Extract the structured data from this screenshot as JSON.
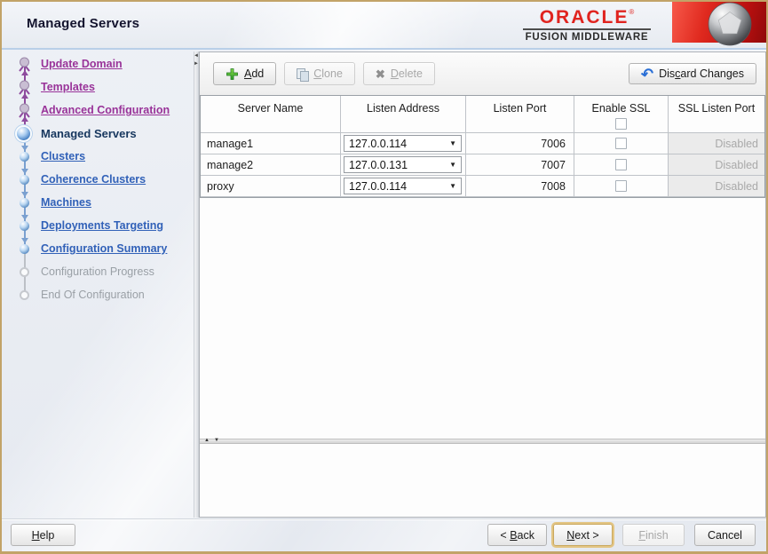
{
  "window_title": "Managed Servers",
  "brand": {
    "name": "ORACLE",
    "registered": "®",
    "subtitle": "FUSION MIDDLEWARE"
  },
  "sidebar": {
    "items": [
      {
        "label": "Update Domain",
        "state": "visited"
      },
      {
        "label": "Templates",
        "state": "visited"
      },
      {
        "label": "Advanced Configuration",
        "state": "visited"
      },
      {
        "label": "Managed Servers",
        "state": "current"
      },
      {
        "label": "Clusters",
        "state": "upcoming"
      },
      {
        "label": "Coherence Clusters",
        "state": "upcoming"
      },
      {
        "label": "Machines",
        "state": "upcoming"
      },
      {
        "label": "Deployments Targeting",
        "state": "upcoming"
      },
      {
        "label": "Configuration Summary",
        "state": "upcoming"
      },
      {
        "label": "Configuration Progress",
        "state": "disabled"
      },
      {
        "label": "End Of Configuration",
        "state": "disabled"
      }
    ]
  },
  "toolbar": {
    "add": {
      "pre": "",
      "key": "A",
      "post": "dd"
    },
    "clone": {
      "pre": "",
      "key": "C",
      "post": "lone"
    },
    "delete": {
      "pre": "",
      "key": "D",
      "post": "elete"
    },
    "discard": {
      "pre": "Dis",
      "key": "c",
      "post": "ard Changes"
    }
  },
  "table": {
    "columns": [
      "Server Name",
      "Listen Address",
      "Listen Port",
      "Enable SSL",
      "SSL Listen Port"
    ],
    "header_ssl_checked": false,
    "rows": [
      {
        "server_name": "manage1",
        "listen_address": "127.0.0.114",
        "listen_port": "7006",
        "enable_ssl": false,
        "ssl_listen_port": "Disabled"
      },
      {
        "server_name": "manage2",
        "listen_address": "127.0.0.131",
        "listen_port": "7007",
        "enable_ssl": false,
        "ssl_listen_port": "Disabled"
      },
      {
        "server_name": "proxy",
        "listen_address": "127.0.0.114",
        "listen_port": "7008",
        "enable_ssl": false,
        "ssl_listen_port": "Disabled"
      }
    ]
  },
  "footer": {
    "help": {
      "pre": "",
      "key": "H",
      "post": "elp"
    },
    "back": {
      "pre": "< ",
      "key": "B",
      "post": "ack"
    },
    "next": {
      "pre": "",
      "key": "N",
      "post": "ext >"
    },
    "finish": {
      "pre": "",
      "key": "F",
      "post": "inish"
    },
    "cancel": "Cancel"
  },
  "icons": {
    "dropdown_arrow": "▼",
    "delete_x": "✖",
    "discard_undo": "↶",
    "splitter_left": "◄",
    "splitter_right": "►",
    "splitter_up": "▲",
    "splitter_down": "▼"
  },
  "colors": {
    "oracle_red": "#e0241f",
    "link_purple": "#993399",
    "link_blue": "#3161b8",
    "current_step": "#17375e",
    "focus_ring": "#e3c583",
    "disabled_cell_bg": "#ebebeb"
  }
}
